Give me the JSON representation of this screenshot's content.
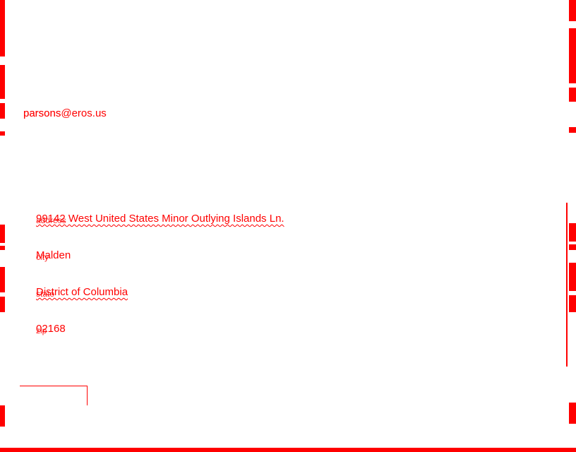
{
  "account": {
    "email": "parsons@eros.us",
    "email_overlay": "parsons"
  },
  "address": {
    "street_label": "address",
    "street_value": "99142 West United States Minor Outlying Islands Ln.",
    "city_label": "city",
    "city_value": "Malden",
    "state_label": "state",
    "state_value": "District of Columbia",
    "zip_label": "zip",
    "zip_value": "02168"
  },
  "theme": {
    "accent": "#ff0000",
    "background": "#ffffff"
  }
}
